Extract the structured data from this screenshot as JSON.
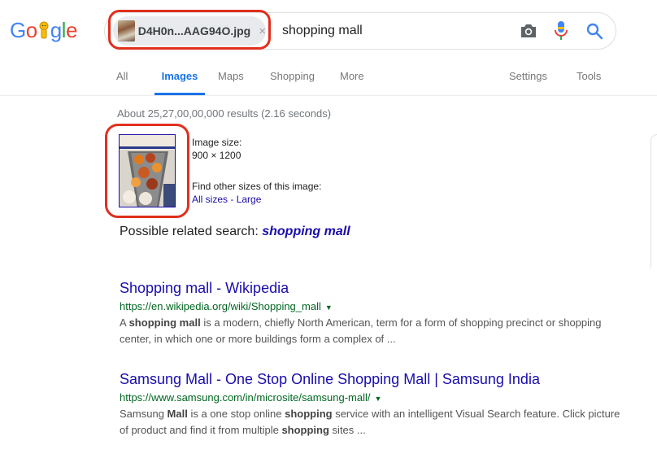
{
  "logo": {
    "letters": [
      "G",
      "o",
      "",
      "g",
      "l",
      "e"
    ]
  },
  "search": {
    "chip_label": "D4H0n...AAG94O.jpg",
    "chip_close": "×",
    "query": "shopping mall"
  },
  "tabs": [
    {
      "label": "All"
    },
    {
      "label": "Images"
    },
    {
      "label": "Maps"
    },
    {
      "label": "Shopping"
    },
    {
      "label": "More"
    },
    {
      "label": "Settings"
    },
    {
      "label": "Tools"
    }
  ],
  "result_stats": "About 25,27,00,00,000 results (2.16 seconds)",
  "image_info": {
    "size_label": "Image size:",
    "size_value": "900 × 1200",
    "find_label": "Find other sizes of this image:",
    "sizes_all": "All sizes",
    "sizes_sep": " - ",
    "sizes_large": "Large"
  },
  "related": {
    "prefix": "Possible related search:",
    "query": "shopping mall"
  },
  "results": [
    {
      "title": "Shopping mall - Wikipedia",
      "url": "https://en.wikipedia.org/wiki/Shopping_mall",
      "snippet_parts": [
        "A ",
        "shopping mall",
        " is a modern, chiefly North American, term for a form of shopping precinct or shopping center, in which one or more buildings form a complex of ..."
      ]
    },
    {
      "title": "Samsung Mall - One Stop Online Shopping Mall | Samsung India",
      "url": "https://www.samsung.com/in/microsite/samsung-mall/",
      "snippet_parts": [
        "Samsung ",
        "Mall",
        " is a one stop online ",
        "shopping",
        " service with an intelligent Visual Search feature. Click picture of product and find it from multiple ",
        "shopping",
        " sites ..."
      ]
    }
  ],
  "colors": {
    "brand_blue": "#4285F4",
    "brand_red": "#EA4335",
    "brand_yellow": "#FBBC05",
    "brand_green": "#34A853",
    "link": "#1a0dab",
    "url_green": "#006621",
    "highlight_red": "#e0301e",
    "tab_active": "#1a73e8"
  },
  "icons": [
    "camera-icon",
    "microphone-icon",
    "search-icon",
    "dropdown-arrow-icon",
    "close-icon"
  ]
}
